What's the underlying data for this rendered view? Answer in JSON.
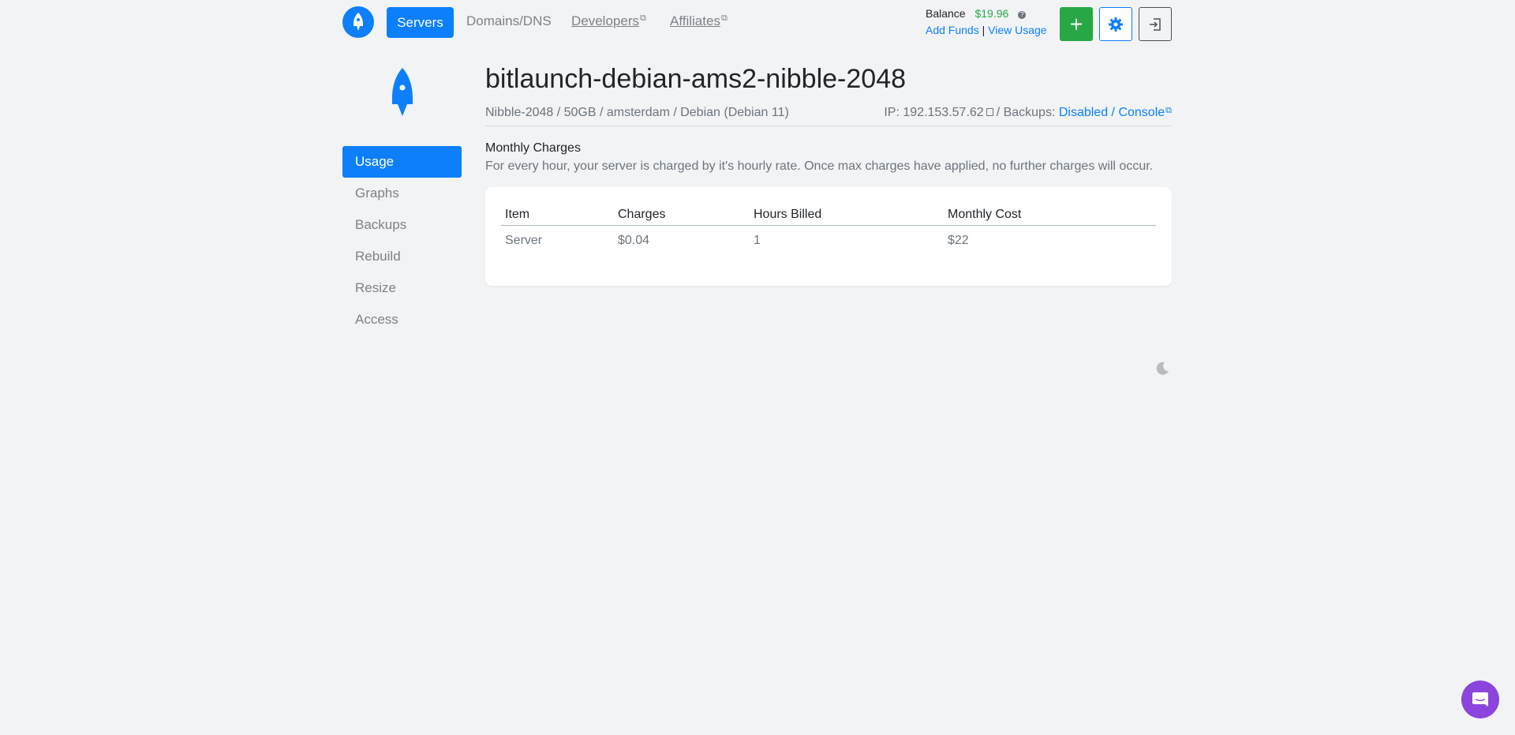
{
  "nav": {
    "servers": "Servers",
    "domains": "Domains/DNS",
    "developers": "Developers",
    "affiliates": "Affiliates",
    "external_glyph": "⧉"
  },
  "account": {
    "balance_label": "Balance",
    "balance_amount": "$19.96",
    "add_funds": "Add Funds",
    "separator": "|",
    "view_usage": "View Usage"
  },
  "actions": {
    "add": "+"
  },
  "sidebar": {
    "items": [
      {
        "label": "Usage",
        "active": true
      },
      {
        "label": "Graphs"
      },
      {
        "label": "Backups"
      },
      {
        "label": "Rebuild"
      },
      {
        "label": "Resize"
      },
      {
        "label": "Access"
      }
    ]
  },
  "server": {
    "name": "bitlaunch-debian-ams2-nibble-2048",
    "specs": "Nibble-2048 / 50GB / amsterdam / Debian (Debian 11)",
    "ip_label": "IP: 192.153.57.62",
    "backups_label": "/ Backups:",
    "backups_link": "Disabled / Console"
  },
  "charges": {
    "title": "Monthly Charges",
    "description": "For every hour, your server is charged by it's hourly rate. Once max charges have applied, no further charges will occur.",
    "columns": [
      "Item",
      "Charges",
      "Hours Billed",
      "Monthly Cost"
    ],
    "rows": [
      [
        "Server",
        "$0.04",
        "1",
        "$22"
      ]
    ]
  },
  "colors": {
    "primary": "#0d7ffb",
    "success": "#28a745",
    "chat": "#8b45dc",
    "background": "#f1f3f5"
  },
  "icons": [
    "rocket-icon",
    "gear-icon",
    "logout-icon",
    "copy-icon",
    "external-link-icon",
    "moon-icon",
    "chat-icon",
    "info-icon"
  ]
}
